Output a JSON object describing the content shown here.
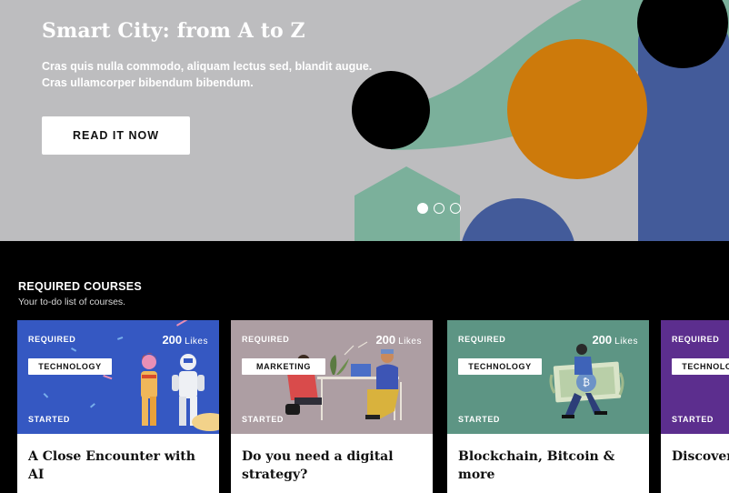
{
  "hero": {
    "title": "Smart City: from A to Z",
    "text_line1": "Cras quis nulla commodo, aliquam lectus sed, blandit augue.",
    "text_line2": "Cras ullamcorper bibendum bibendum.",
    "cta_label": "READ IT NOW",
    "carousel": {
      "slide_count": 3,
      "active_index": 0
    },
    "colors": {
      "background": "#bdbdbf",
      "green": "#7bb09b",
      "orange": "#cd7a0b",
      "blue": "#435b9a",
      "black": "#000000"
    }
  },
  "section": {
    "title": "REQUIRED COURSES",
    "subtitle": "Your to-do list of courses."
  },
  "courses": [
    {
      "tag": "REQUIRED",
      "likes_count": "200",
      "likes_label": "Likes",
      "category": "TECHNOLOGY",
      "status": "STARTED",
      "title": "A Close Encounter with AI",
      "color": "#3558c2"
    },
    {
      "tag": "REQUIRED",
      "likes_count": "200",
      "likes_label": "Likes",
      "category": "MARKETING",
      "status": "STARTED",
      "title": "Do you need a digital strategy?",
      "color": "#ad9ea3"
    },
    {
      "tag": "REQUIRED",
      "likes_count": "200",
      "likes_label": "Likes",
      "category": "TECHNOLOGY",
      "status": "STARTED",
      "title": "Blockchain, Bitcoin & more",
      "color": "#5d9584"
    },
    {
      "tag": "REQUIRED",
      "category": "TECHNOLOGY",
      "status": "STARTED",
      "title": "Discover",
      "color": "#5c2e8e"
    }
  ]
}
